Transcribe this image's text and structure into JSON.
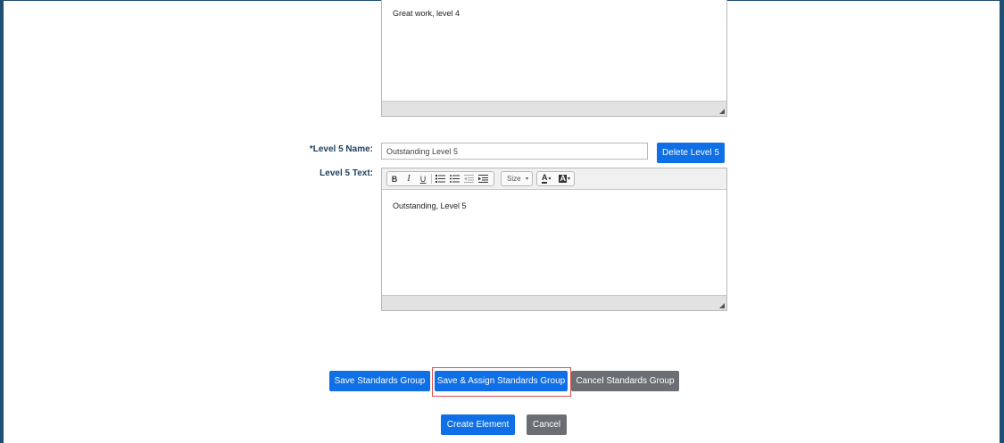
{
  "level4": {
    "text": "Great work, level 4"
  },
  "level5": {
    "name_label": "*Level 5 Name:",
    "name_value": "Outstanding Level 5",
    "delete_label": "Delete Level 5",
    "text_label": "Level 5 Text:",
    "text": "Outstanding, Level 5"
  },
  "toolbar": {
    "bold": "B",
    "italic": "I",
    "underline": "U",
    "size_label": "Size",
    "font_color": "A",
    "bg_color": "A"
  },
  "actions": {
    "save_group": "Save Standards Group",
    "save_assign": "Save & Assign Standards Group",
    "cancel_group": "Cancel Standards Group",
    "create_element": "Create Element",
    "cancel": "Cancel"
  },
  "colors": {
    "primary": "#0f6fe6",
    "secondary": "#6b6f73",
    "highlight": "#e14b4b",
    "frame": "#1e4e74"
  }
}
